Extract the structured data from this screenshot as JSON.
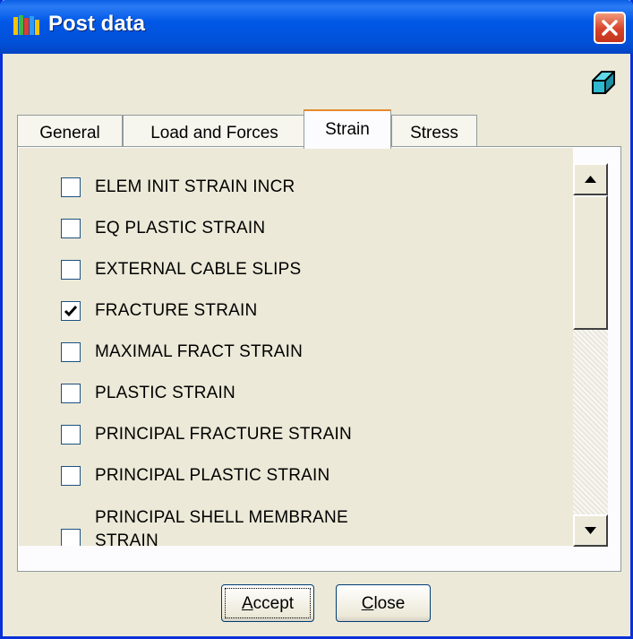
{
  "window": {
    "title": "Post data",
    "icon": "app-logo-icon"
  },
  "toolbar": {
    "eraser_icon": "eraser-icon"
  },
  "tabs": [
    {
      "label": "General",
      "active": false
    },
    {
      "label": "Load and Forces",
      "active": false
    },
    {
      "label": "Strain",
      "active": true
    },
    {
      "label": "Stress",
      "active": false
    }
  ],
  "items": [
    {
      "label": "ELEM INIT STRAIN INCR",
      "checked": false
    },
    {
      "label": "EQ PLASTIC STRAIN",
      "checked": false
    },
    {
      "label": "EXTERNAL CABLE SLIPS",
      "checked": false
    },
    {
      "label": "FRACTURE STRAIN",
      "checked": true
    },
    {
      "label": "MAXIMAL FRACT STRAIN",
      "checked": false
    },
    {
      "label": "PLASTIC STRAIN",
      "checked": false
    },
    {
      "label": "PRINCIPAL FRACTURE STRAIN",
      "checked": false
    },
    {
      "label": "PRINCIPAL PLASTIC STRAIN",
      "checked": false
    },
    {
      "label": "PRINCIPAL SHELL MEMBRANE STRAIN",
      "checked": false
    }
  ],
  "buttons": {
    "accept_mnemonic": "A",
    "accept_rest": "ccept",
    "close_mnemonic": "C",
    "close_rest": "lose"
  },
  "colors": {
    "titlebar": "#0058e6",
    "dialog_bg": "#ece9d8",
    "active_tab_accent": "#e68b2c",
    "close_button": "#d7432a"
  }
}
